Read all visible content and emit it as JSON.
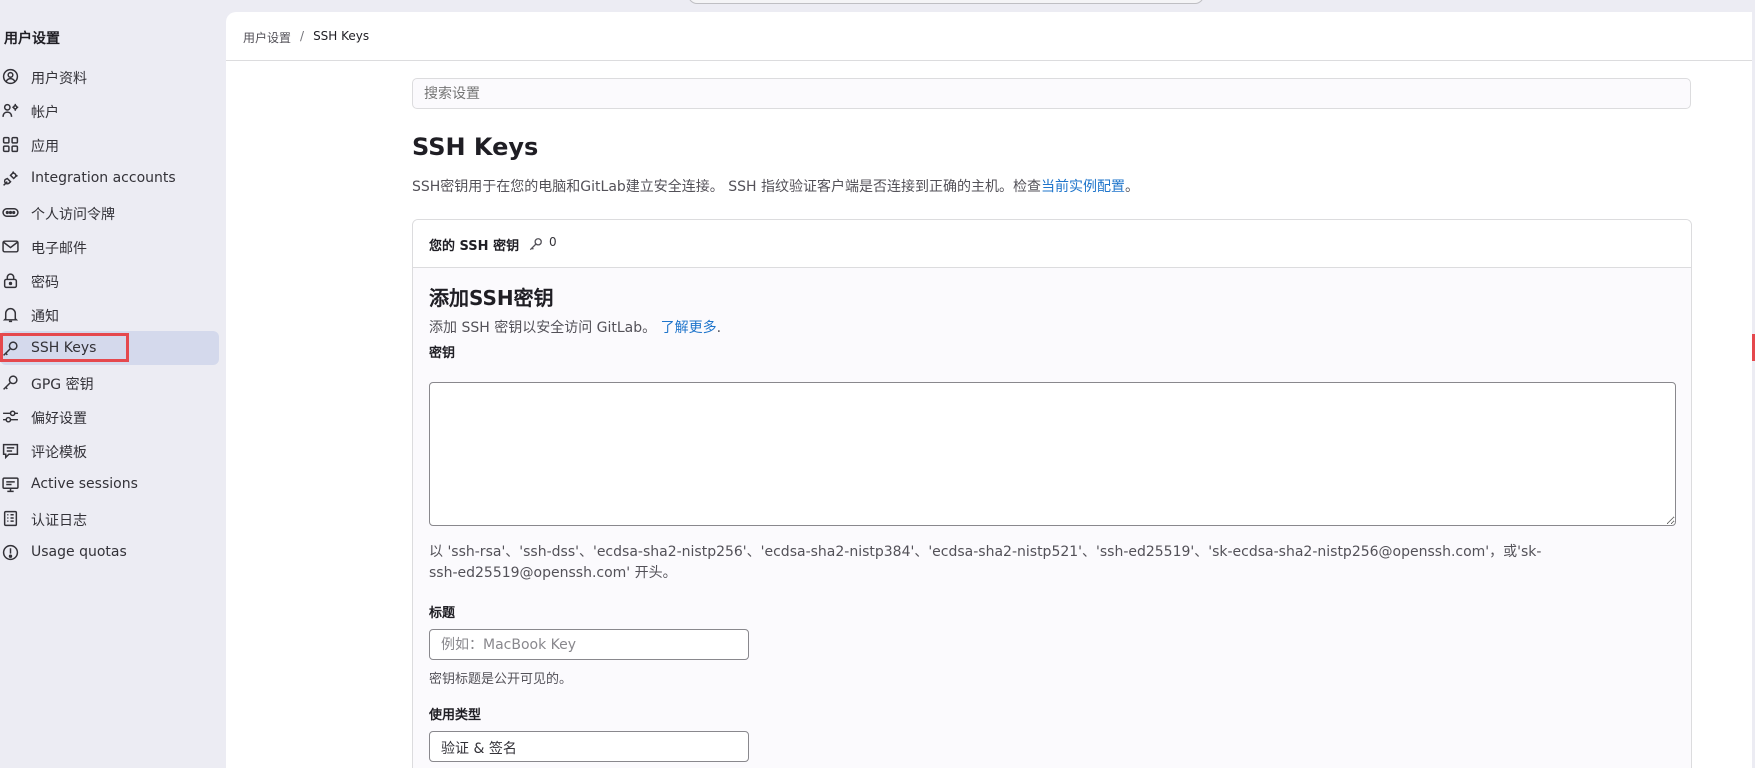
{
  "sidebar": {
    "title": "用户设置",
    "items": [
      {
        "label": "用户资料",
        "icon": "profile-icon"
      },
      {
        "label": "帐户",
        "icon": "account-icon"
      },
      {
        "label": "应用",
        "icon": "applications-icon"
      },
      {
        "label": "Integration accounts",
        "icon": "integration-icon"
      },
      {
        "label": "个人访问令牌",
        "icon": "token-icon"
      },
      {
        "label": "电子邮件",
        "icon": "mail-icon"
      },
      {
        "label": "密码",
        "icon": "lock-icon"
      },
      {
        "label": "通知",
        "icon": "bell-icon"
      },
      {
        "label": "SSH Keys",
        "icon": "key-icon",
        "active": true
      },
      {
        "label": "GPG 密钥",
        "icon": "key-icon"
      },
      {
        "label": "偏好设置",
        "icon": "preferences-icon"
      },
      {
        "label": "评论模板",
        "icon": "comment-icon"
      },
      {
        "label": "Active sessions",
        "icon": "monitor-icon"
      },
      {
        "label": "认证日志",
        "icon": "log-icon"
      },
      {
        "label": "Usage quotas",
        "icon": "quota-icon"
      }
    ]
  },
  "breadcrumb": {
    "parent": "用户设置",
    "separator": "/",
    "current": "SSH Keys"
  },
  "search": {
    "placeholder": "搜索设置"
  },
  "page": {
    "title": "SSH Keys",
    "description_prefix": "SSH密钥用于在您的电脑和GitLab建立安全连接。 SSH 指纹验证客户端是否连接到正确的主机。检查",
    "description_link": "当前实例配置",
    "description_suffix": "。"
  },
  "card": {
    "header_title": "您的 SSH 密钥",
    "key_count": "0",
    "section_title": "添加SSH密钥",
    "section_desc_prefix": "添加 SSH 密钥以安全访问 GitLab。",
    "section_desc_link": "了解更多",
    "section_desc_suffix": ".",
    "key_label": "密钥",
    "key_help": "以 'ssh-rsa'、'ssh-dss'、'ecdsa-sha2-nistp256'、'ecdsa-sha2-nistp384'、'ecdsa-sha2-nistp521'、'ssh-ed25519'、'sk-ecdsa-sha2-nistp256@openssh.com'，或'sk-ssh-ed25519@openssh.com' 开头。",
    "title_label": "标题",
    "title_placeholder": "例如：MacBook Key",
    "title_help": "密钥标题是公开可见的。",
    "usage_label": "使用类型",
    "usage_value": "验证 & 签名"
  },
  "colors": {
    "accent_link": "#1f75cb",
    "active_bg": "#d4d9ec",
    "highlight": "#e5484d"
  }
}
